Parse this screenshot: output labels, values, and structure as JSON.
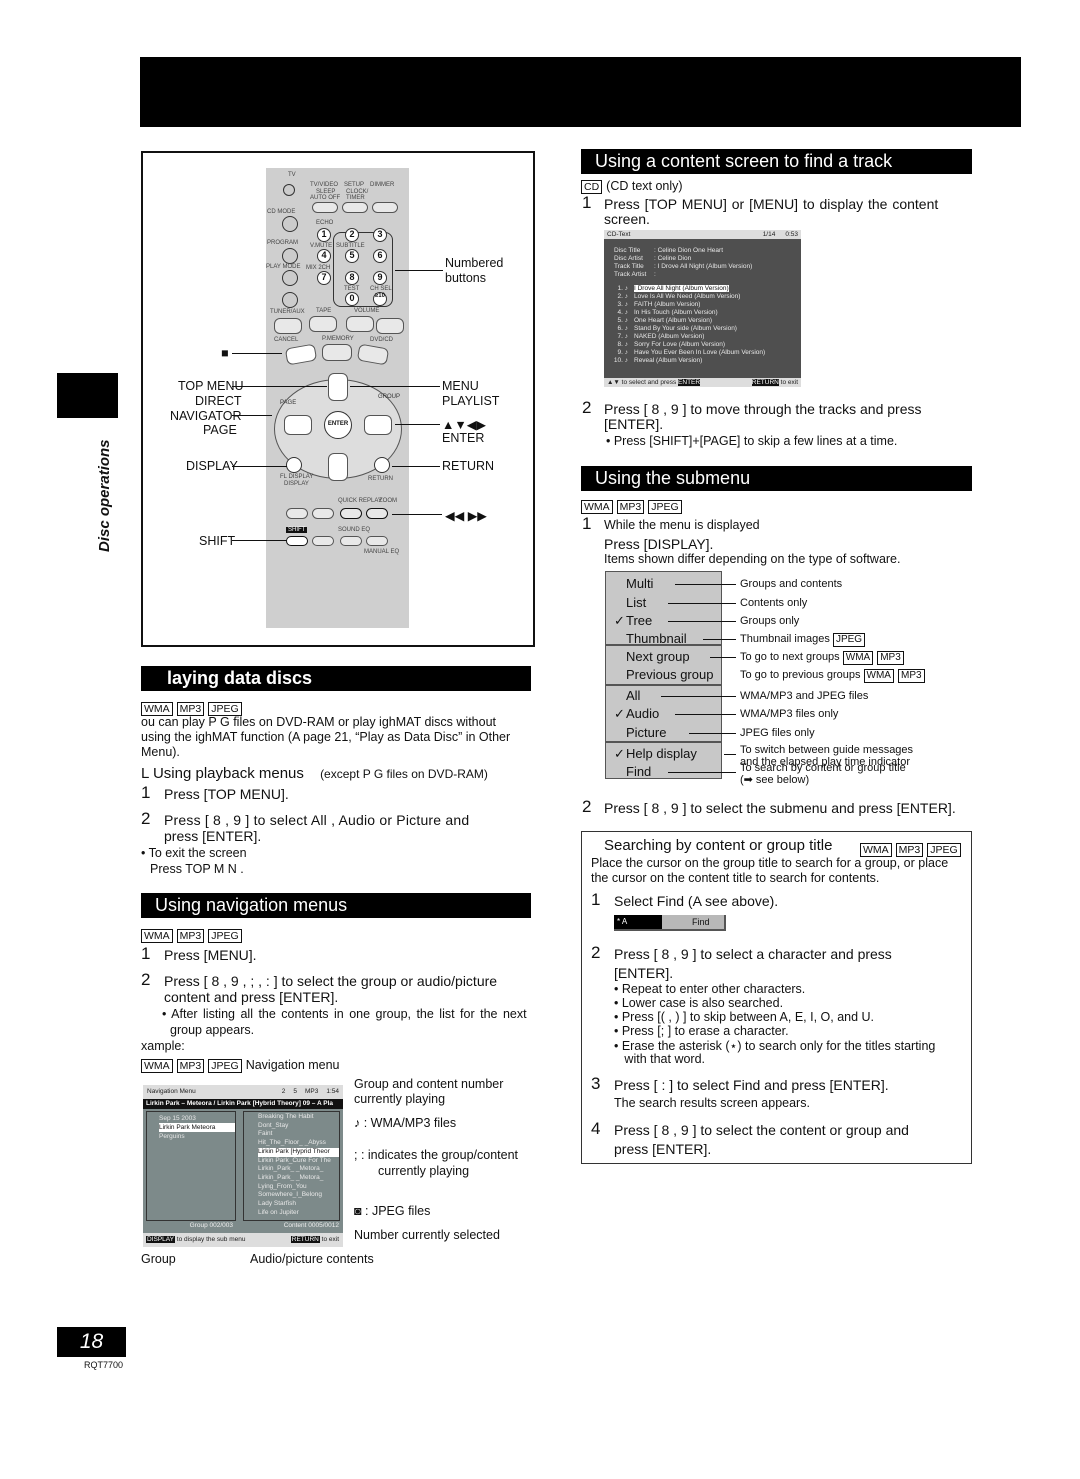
{
  "side_tab": "Disc operations",
  "remote": {
    "labels_left": [
      "TOP MENU",
      "DIRECT",
      "NAVIGATOR",
      "PAGE",
      "DISPLAY",
      "SHIFT"
    ],
    "labels_right": [
      "MENU",
      "PLAYLIST",
      "▲▼◀▶",
      "ENTER",
      "RETURN"
    ],
    "numbered": "Numbered\nbuttons",
    "stop_symbol": "■",
    "skip_symbols": "◀◀ ▶▶",
    "digits": [
      "1",
      "2",
      "3",
      "4",
      "5",
      "6",
      "7",
      "8",
      "9",
      "0",
      "≥10"
    ],
    "small_labels": [
      "TV",
      "TV/VIDEO",
      "SETUP",
      "DIMMER",
      "SLEEP",
      "CLOCK/",
      "PLAY",
      "AUTO OFF",
      "TIMER",
      "REC",
      "CD MODE",
      "DISC",
      "ECHO",
      "PROGRAM",
      "V.MUTE",
      "SUBTITLE",
      "AUDIO",
      "PLAY MODE",
      "MIX 2CH",
      "REPEAT",
      "TEST",
      "CH SEL",
      "TUNER/AUX",
      "TAPE",
      "VOLUME",
      "CANCEL",
      "P.MEMORY",
      "DVD/CD",
      "DIRECT NAVIGATOR",
      "TOP MENU",
      "PLAYLIST",
      "MENU",
      "PAGE",
      "GROUP",
      "ENTER",
      "FL DISPLAY",
      "DISPLAY",
      "RETURN",
      "SKIP",
      "QUICK REPLAY",
      "ZOOM",
      "SHIFT",
      "SOUND EQ",
      "MANUAL EQ"
    ]
  },
  "playing": {
    "title": "laying data discs",
    "tags": [
      "WMA",
      "MP3",
      "JPEG"
    ],
    "intro": [
      "ou can play   P  G files on DVD-RAM or play    ighMAT discs without",
      "using the    ighMAT function (A   page 21, “Play as Data Disc” in Other",
      "Menu)."
    ],
    "sub_mark": "L",
    "sub_title": "Using playback menus",
    "sub_note": "(except   P  G files on DVD-RAM)",
    "step1": "Press [TOP MENU].",
    "step2a": "Press [ 8 , 9 ] to select   All  ,  Audio    or  Picture    and",
    "step2b": "press [ENTER].",
    "bullet1": "• To exit the screen",
    "bullet1b": "Press  TOP M  N   ."
  },
  "nav": {
    "title": "Using navigation menus",
    "tags": [
      "WMA",
      "MP3",
      "JPEG"
    ],
    "step1": "Press [MENU].",
    "step2a": "Press [ 8 , 9 ,  ;  , :  ] to select the group or audio/picture",
    "step2b": "content and press [ENTER].",
    "bullet": "• After listing all the contents in one group, the list for the next",
    "bullet_b": "group appears.",
    "example": "xample:",
    "caption": "Navigation menu",
    "screen": {
      "header": "Navigation Menu",
      "g": "2",
      "c": "5",
      "fmt": "MP3",
      "time": "1:54",
      "title": "Lirkin Park – Meteora / Lirkin  Park [Hybrid Theory]  09  –  A Pla",
      "groups": [
        "Sep 15 2003",
        "Lirkin Park    Meteora",
        "Perguins"
      ],
      "contents": [
        "Breaking The Habit",
        "Dont_Stay",
        "Faint",
        "Hit_The_Floor_   _Abyss",
        "Lirkin Park [Hyprid Theor",
        "Lirkin Park_Cure For The",
        "Lirkin_Park_    _Metora_",
        "Lirkin_Park_    _Metora_",
        "Lying_From_You",
        "Somewhere_I_Belong",
        "Lady Starfish",
        "Life on Jupiter"
      ],
      "group_count": "Group 002/003",
      "content_count": "Content 0005/0012",
      "display": "DISPLAY",
      "display_text": "to display the sub menu",
      "return": "RETURN",
      "return_text": "to exit"
    },
    "callouts": [
      "Group and content number",
      "currently playing",
      "♪  : WMA/MP3 files",
      ";   : indicates the group/content",
      "currently playing",
      "◙  : JPEG files",
      "Number currently selected"
    ],
    "bottom": [
      "Group",
      "Audio/picture contents"
    ]
  },
  "content": {
    "title": "Using a content screen to find a track",
    "tag": "CD",
    "tag_note": "(CD text only)",
    "step1a": "Press [TOP MENU] or [MENU] to display the content",
    "step1b": "screen.",
    "screen": {
      "header": "CD-Text",
      "track": "1/14",
      "time": "0:53",
      "info": [
        [
          "Disc Title",
          ": Celine Dion    One Heart"
        ],
        [
          "Disc Artist",
          ": Celine Dion"
        ],
        [
          "Track Title",
          ": I Drove All Night (Album Version)"
        ],
        [
          "Track Artist",
          ":"
        ]
      ],
      "tracks": [
        "I Drove All Night (Album Version)",
        "Love Is All We Need (Album Version)",
        "FAITH (Album Version)",
        "In His Touch (Album Version)",
        "One Heart (Album Version)",
        "Stand By Your side (Album Version)",
        "NAKED (Album Version)",
        "Sorry For Love (Album Version)",
        "Have You Ever Been In Love (Album Version)",
        "Reveal (Album Version)"
      ],
      "footer_l": "▲▼ to select and press",
      "enter": "ENTER",
      "return": "RETURN",
      "footer_r": "to exit"
    },
    "step2a": "Press [ 8 , 9 ] to move through the tracks and press",
    "step2b": "[ENTER].",
    "bullet": "• Press [SHIFT]+[PAGE] to skip a few lines at a time."
  },
  "submenu": {
    "title": "Using the submenu",
    "tags": [
      "WMA",
      "MP3",
      "JPEG"
    ],
    "step1": "While the menu is displayed",
    "step1b": "Press [DISPLAY].",
    "note": "Items shown differ depending on the type of software.",
    "items": [
      {
        "label": "Multi",
        "checked": false,
        "desc": "Groups and contents"
      },
      {
        "label": "List",
        "checked": false,
        "desc": "Contents only"
      },
      {
        "label": "Tree",
        "checked": true,
        "desc": "Groups only"
      },
      {
        "label": "Thumbnail",
        "checked": false,
        "desc": "Thumbnail images",
        "tags": "JPEG"
      },
      {
        "label": "Next group",
        "checked": false,
        "desc": "To go to next groups",
        "tags": "WMA MP3"
      },
      {
        "label": "Previous group",
        "checked": false,
        "desc": "To go to previous groups",
        "tags": "WMA MP3"
      },
      {
        "label": "All",
        "checked": false,
        "desc": "WMA/MP3 and JPEG files"
      },
      {
        "label": "Audio",
        "checked": true,
        "desc": "WMA/MP3 files only"
      },
      {
        "label": "Picture",
        "checked": false,
        "desc": "JPEG files only"
      },
      {
        "label": "Help display",
        "checked": true,
        "desc": "To switch between guide messages",
        "desc2": "and the elapsed play time indicator"
      },
      {
        "label": "Find",
        "checked": false,
        "desc": "To search by content or group title",
        "desc2": "(➡ see below)"
      }
    ],
    "check": "✓",
    "tag_wma": "WMA",
    "tag_mp3": "MP3",
    "tag_jpeg": "JPEG",
    "step2": "Press [ 8 , 9 ] to select the submenu and press [ENTER]."
  },
  "search": {
    "title": "Searching by content or group title",
    "tags": [
      "WMA",
      "MP3",
      "JPEG"
    ],
    "intro": [
      "Place the cursor on the group title to search for a group, or place",
      "the cursor on the content title to search for contents."
    ],
    "step1": "Select   Find   (A   see above).",
    "field_value": "* A",
    "find_label": "Find",
    "step2a": "Press [ 8 , 9 ] to select a character and press",
    "step2b": "[ENTER].",
    "bullets": [
      "• Repeat to enter other characters.",
      "• Lower case is also searched.",
      "• Press [(      ,  )      ] to skip between A, E, I, O, and U.",
      "• Press [;  ] to erase a character.",
      "• Erase the asterisk (⋆) to search only for the titles starting",
      "   with that word."
    ],
    "step3": "Press [ :  ] to select    Find    and press [ENTER].",
    "step3_note": "The search results screen appears.",
    "step4a": "Press [ 8 , 9 ] to select the content or group and",
    "step4b": "press [ENTER]."
  },
  "footer": {
    "page": "18",
    "code": "RQT7700"
  },
  "colors": {
    "bar": "#000000",
    "screen": "#4f4f4f",
    "submenu": "#c8c8c8",
    "remote": "#cfcfcf"
  }
}
